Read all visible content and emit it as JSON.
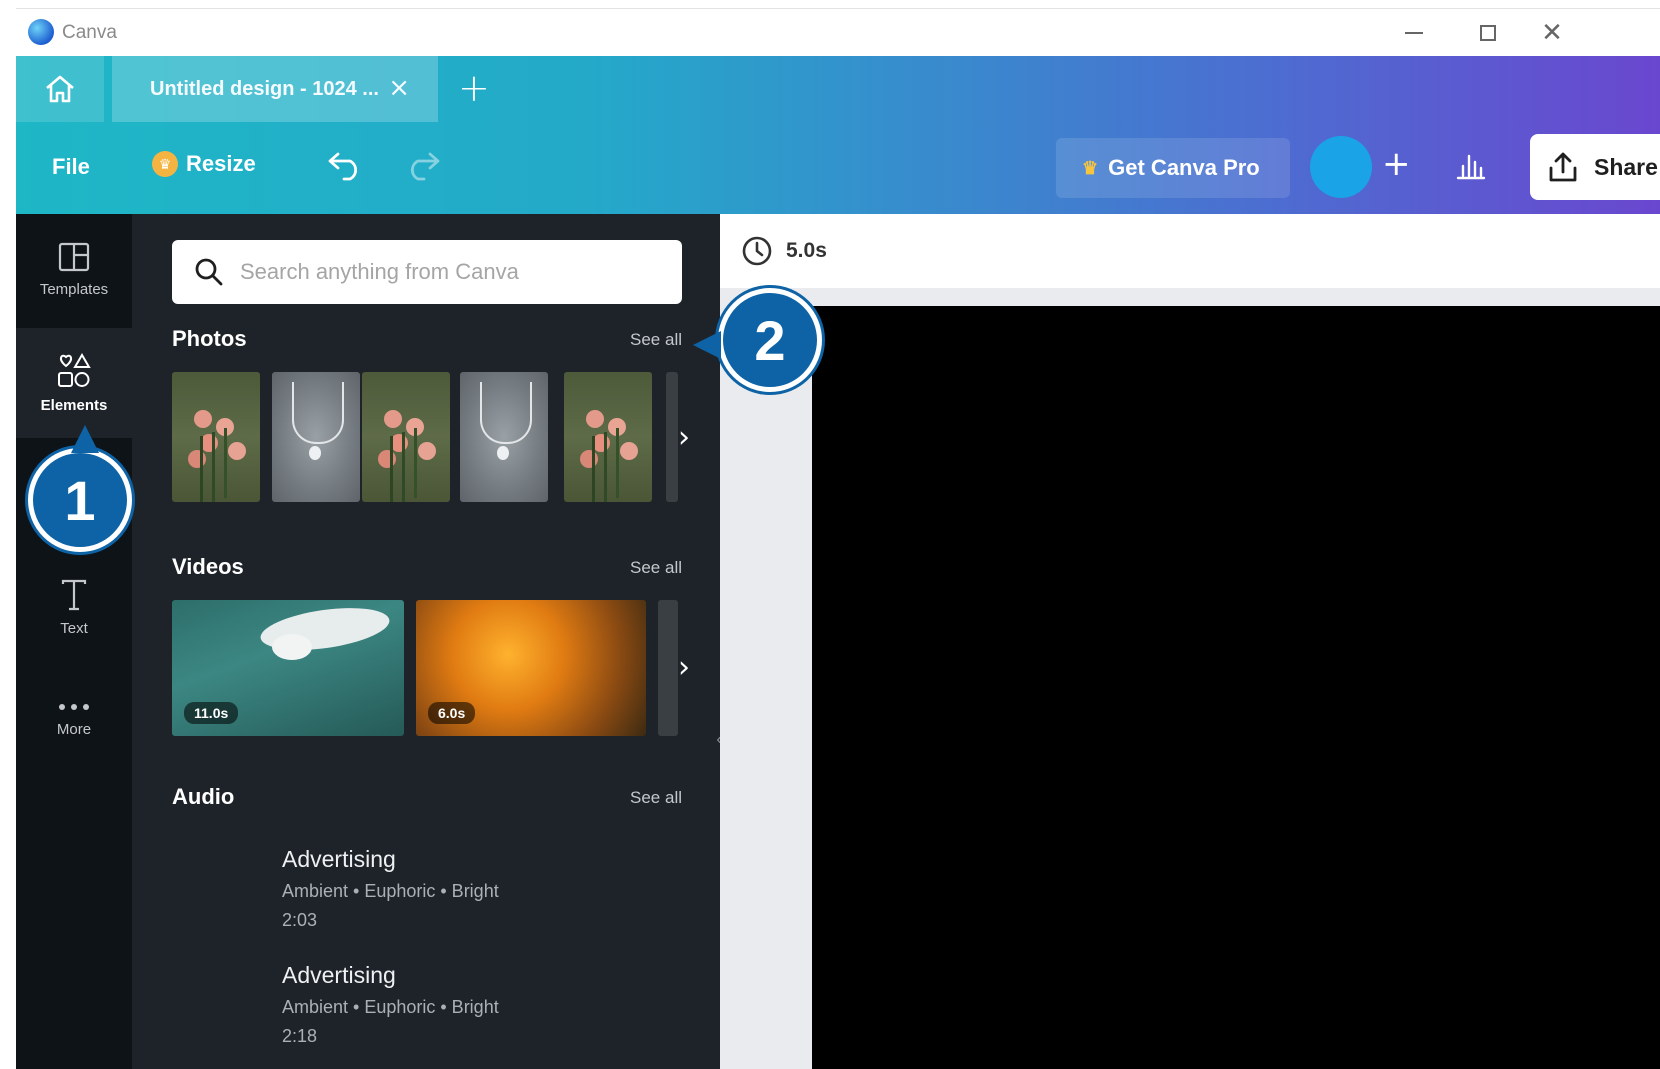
{
  "window": {
    "app_name": "Canva",
    "controls": [
      "minimize",
      "maximize",
      "close"
    ]
  },
  "tabs": {
    "home_icon": "home-icon",
    "active_tab_title": "Untitled design - 1024 ...",
    "close_symbol": "×",
    "new_tab_symbol": "+"
  },
  "toolbar": {
    "file_label": "File",
    "resize_label": "Resize",
    "undo_icon": "undo-icon",
    "redo_icon": "redo-icon",
    "get_pro_label": "Get Canva Pro",
    "add_symbol": "+",
    "share_label": "Share"
  },
  "rail": {
    "items": [
      {
        "label": "Templates",
        "icon": "templates-icon"
      },
      {
        "label": "Elements",
        "icon": "elements-icon",
        "active": true
      },
      {
        "label": "Text",
        "icon": "text-icon"
      },
      {
        "label": "More",
        "icon": "more-icon"
      }
    ]
  },
  "panel": {
    "search_placeholder": "Search anything from Canva",
    "photos": {
      "title": "Photos",
      "see_all": "See all"
    },
    "videos": {
      "title": "Videos",
      "see_all": "See all",
      "items": [
        {
          "duration": "11.0s"
        },
        {
          "duration": "6.0s"
        }
      ]
    },
    "audio": {
      "title": "Audio",
      "see_all": "See all",
      "items": [
        {
          "title": "Advertising",
          "tags": "Ambient • Euphoric • Bright",
          "duration": "2:03"
        },
        {
          "title": "Advertising",
          "tags": "Ambient • Euphoric • Bright",
          "duration": "2:18"
        }
      ]
    }
  },
  "canvas": {
    "duration": "5.0s",
    "background": "#000000"
  },
  "callouts": [
    "1",
    "2"
  ],
  "colors": {
    "accent_start": "#1eb7c6",
    "accent_end": "#6a47cf",
    "panel_bg": "#1e2329",
    "rail_bg": "#0e1318",
    "callout": "#0d63a5"
  }
}
